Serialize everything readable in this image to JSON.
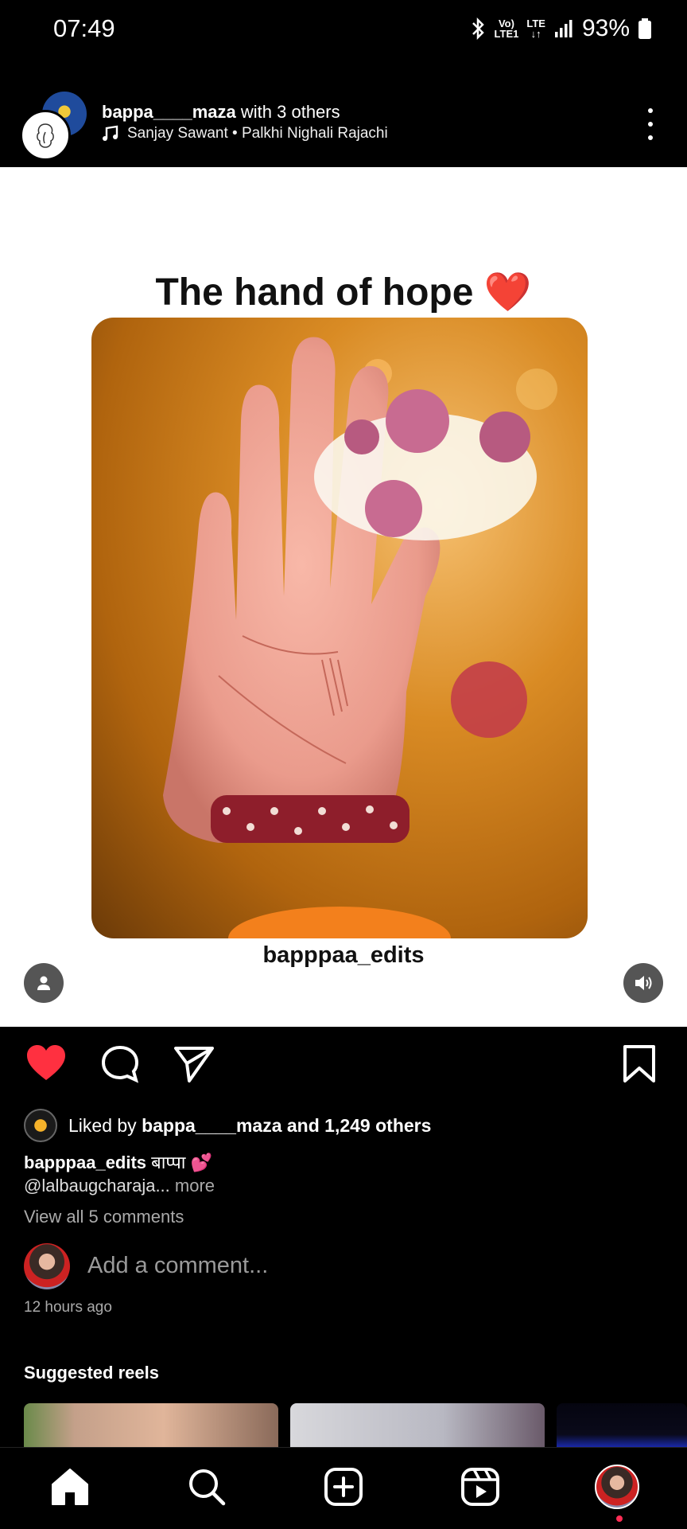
{
  "status_bar": {
    "time": "07:49",
    "signal_text_top": "Vo)",
    "signal_text_bottom": "LTE1",
    "lte_top": "LTE",
    "lte_bottom": "↓↑",
    "battery": "93%"
  },
  "post": {
    "username": "bappa____maza",
    "with_text": "with 3 others",
    "audio": "Sanjay Sawant • Palkhi Nighali Rajachi"
  },
  "reel": {
    "title_text": "The hand of hope",
    "title_emoji": "❤️",
    "credit": "bapppaa_edits"
  },
  "engagement": {
    "liked_prefix": "Liked by",
    "liked_user": "bappa____maza",
    "liked_suffix": "and 1,249 others",
    "like_state": "liked",
    "accent_color": "#ff3040"
  },
  "caption": {
    "author": "bapppaa_edits",
    "text": "बाप्पा 💕",
    "mention": "@lalbaugcharaja...",
    "more": "more"
  },
  "comments": {
    "view_all": "View all 5 comments",
    "placeholder": "Add a comment...",
    "timestamp": "12 hours ago"
  },
  "suggested": {
    "heading": "Suggested reels"
  },
  "bottom_nav": {
    "items": [
      "home-icon",
      "search-icon",
      "create-icon",
      "reels-icon",
      "profile-avatar"
    ],
    "active": "home"
  }
}
